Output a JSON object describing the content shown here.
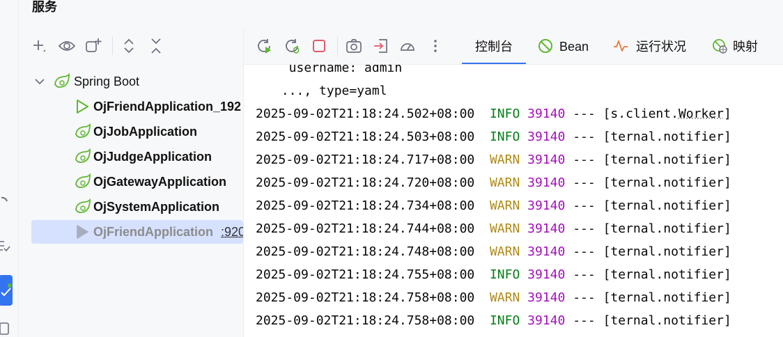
{
  "panel_title": "服务",
  "tree": {
    "root": {
      "label": "Spring Boot"
    },
    "items": [
      {
        "label": "OjFriendApplication_192",
        "port": "",
        "state": "running"
      },
      {
        "label": "OjJobApplication",
        "port": "",
        "state": "idle"
      },
      {
        "label": "OjJudgeApplication",
        "port": "",
        "state": "idle"
      },
      {
        "label": "OjGatewayApplication",
        "port": "",
        "state": "idle"
      },
      {
        "label": "OjSystemApplication",
        "port": "",
        "state": "idle"
      },
      {
        "label": "OjFriendApplication",
        "port": ":920",
        "state": "stopped"
      }
    ]
  },
  "tabs": [
    {
      "label": "控制台",
      "active": true
    },
    {
      "label": "Bean",
      "active": false
    },
    {
      "label": "运行状况",
      "active": false
    },
    {
      "label": "映射",
      "active": false
    }
  ],
  "console": {
    "pre_lines": [
      "  username: admin",
      " ..., type=yaml"
    ],
    "logs": [
      {
        "timestamp": "2025-09-02T21:18:24.502+08:00",
        "level": "INFO",
        "pid": "39140",
        "sep": "---",
        "thread_pre": "[s.client.",
        "thread_mark": "Worker",
        "thread_post": "]"
      },
      {
        "timestamp": "2025-09-02T21:18:24.503+08:00",
        "level": "INFO",
        "pid": "39140",
        "sep": "---",
        "thread_pre": "[ternal.notifier]",
        "thread_mark": "",
        "thread_post": ""
      },
      {
        "timestamp": "2025-09-02T21:18:24.717+08:00",
        "level": "WARN",
        "pid": "39140",
        "sep": "---",
        "thread_pre": "[ternal.notifier]",
        "thread_mark": "",
        "thread_post": ""
      },
      {
        "timestamp": "2025-09-02T21:18:24.720+08:00",
        "level": "WARN",
        "pid": "39140",
        "sep": "---",
        "thread_pre": "[ternal.notifier]",
        "thread_mark": "",
        "thread_post": ""
      },
      {
        "timestamp": "2025-09-02T21:18:24.734+08:00",
        "level": "WARN",
        "pid": "39140",
        "sep": "---",
        "thread_pre": "[ternal.notifier]",
        "thread_mark": "",
        "thread_post": ""
      },
      {
        "timestamp": "2025-09-02T21:18:24.744+08:00",
        "level": "WARN",
        "pid": "39140",
        "sep": "---",
        "thread_pre": "[ternal.notifier]",
        "thread_mark": "",
        "thread_post": ""
      },
      {
        "timestamp": "2025-09-02T21:18:24.748+08:00",
        "level": "WARN",
        "pid": "39140",
        "sep": "---",
        "thread_pre": "[ternal.notifier]",
        "thread_mark": "",
        "thread_post": ""
      },
      {
        "timestamp": "2025-09-02T21:18:24.755+08:00",
        "level": "INFO",
        "pid": "39140",
        "sep": "---",
        "thread_pre": "[ternal.notifier]",
        "thread_mark": "",
        "thread_post": ""
      },
      {
        "timestamp": "2025-09-02T21:18:24.758+08:00",
        "level": "WARN",
        "pid": "39140",
        "sep": "---",
        "thread_pre": "[ternal.notifier]",
        "thread_mark": "",
        "thread_post": ""
      },
      {
        "timestamp": "2025-09-02T21:18:24.758+08:00",
        "level": "INFO",
        "pid": "39140",
        "sep": "---",
        "thread_pre": "[ternal.notifier]",
        "thread_mark": "",
        "thread_post": ""
      }
    ]
  },
  "icons": {
    "left_toolbar": [
      "add-icon",
      "eye-icon",
      "add-window-icon",
      "expand-all-icon",
      "collapse-all-icon"
    ],
    "right_toolbar": [
      "rerun-icon",
      "debug-rerun-icon",
      "stop-icon",
      "screenshot-icon",
      "exit-icon",
      "gauge-icon",
      "more-vertical-icon"
    ]
  },
  "colors": {
    "accent": "#3574f0",
    "info": "#067d17",
    "warn": "#b08b18",
    "pid": "#a40fbb",
    "spring": "#5fb832",
    "stop": "#e55765",
    "selection": "#d5e1ff"
  }
}
